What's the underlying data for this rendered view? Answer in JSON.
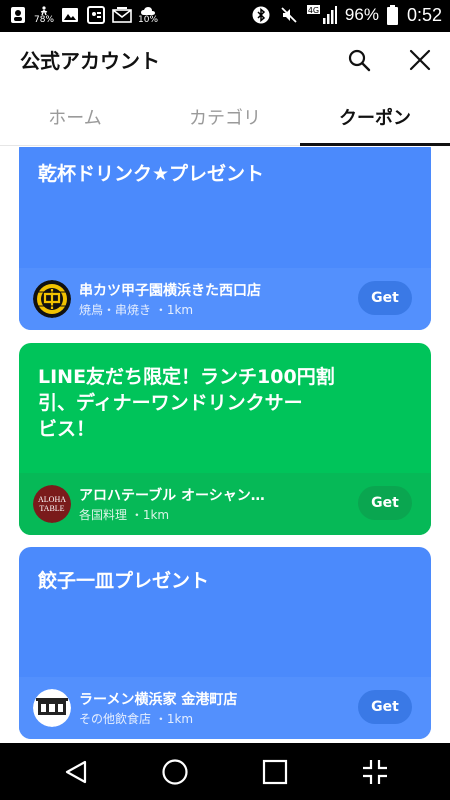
{
  "status_bar": {
    "left_icons": [
      "contact-icon",
      "walking-icon",
      "image-icon",
      "profile-card-icon",
      "mail-icon",
      "weather-icon"
    ],
    "step_percent": "78%",
    "weather_percent": "10%",
    "network_label": "4G",
    "battery_percent": "96%",
    "time": "0:52"
  },
  "header": {
    "title": "公式アカウント"
  },
  "tabs": [
    {
      "label": "ホーム",
      "active": false
    },
    {
      "label": "カテゴリ",
      "active": false
    },
    {
      "label": "クーポン",
      "active": true
    }
  ],
  "coupons": [
    {
      "title": "乾杯ドリンク★プレゼント",
      "shop_name": "串カツ甲子園横浜きた西口店",
      "shop_meta": "焼鳥・串焼き ・1km",
      "get_label": "Get",
      "color": "#4b8afc"
    },
    {
      "title": "LINE友だち限定！ランチ100円割引、ディナーワンドリンクサービス！",
      "title_lines": [
        "LINE友だち限定！ランチ100円割",
        "引、ディナーワンドリンクサー",
        "ビス！"
      ],
      "shop_name": "アロハテーブル オーシャン…",
      "shop_meta": "各国料理 ・1km",
      "shop_logo_text": [
        "ALOHA",
        "TABLE"
      ],
      "get_label": "Get",
      "color": "#00c45a"
    },
    {
      "title": "餃子一皿プレゼント",
      "shop_name": "ラーメン横浜家 金港町店",
      "shop_meta": "その他飲食店 ・1km",
      "get_label": "Get",
      "color": "#4b8afc"
    }
  ],
  "navbar": {
    "buttons": [
      "back-icon",
      "home-icon",
      "recent-apps-icon",
      "split-screen-icon"
    ]
  }
}
